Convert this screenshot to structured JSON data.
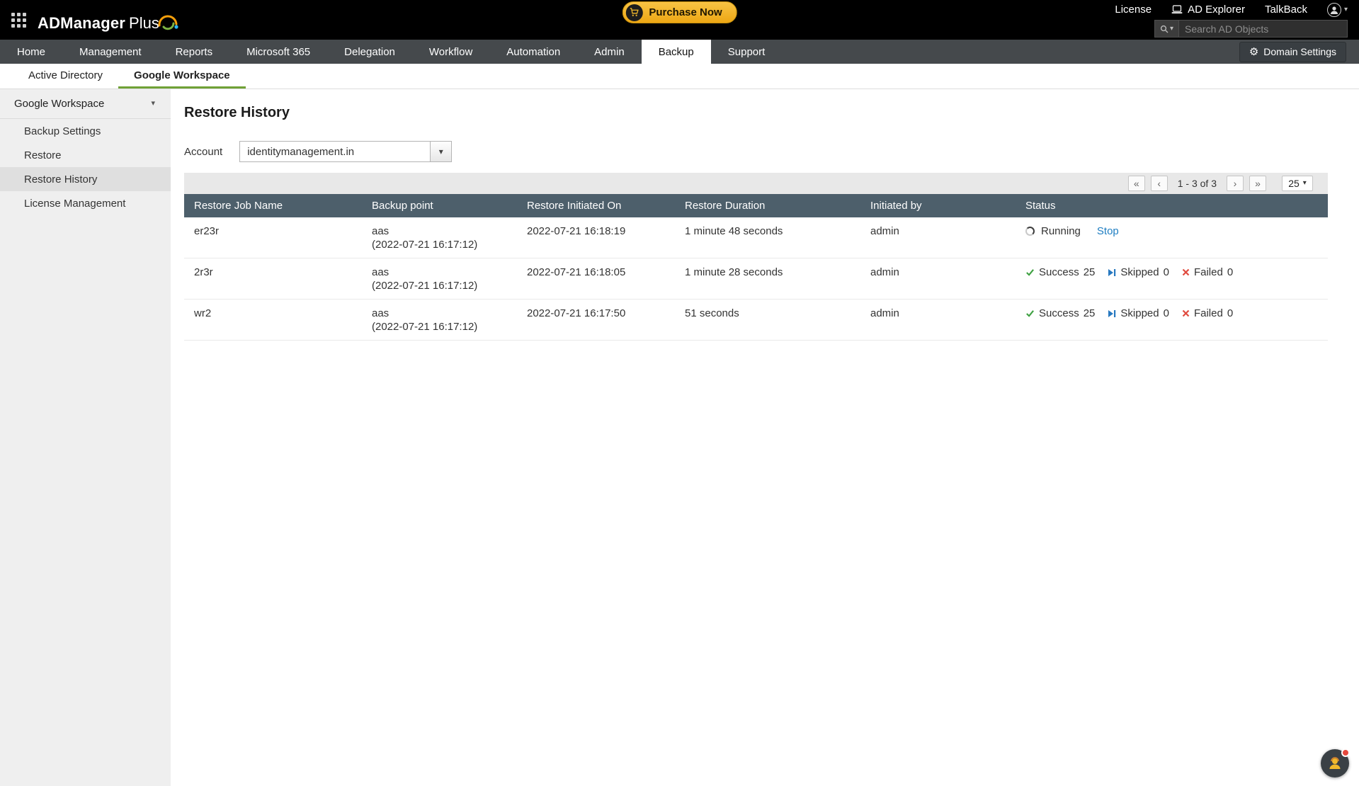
{
  "topbar": {
    "logo": {
      "part1": "ADManager",
      "part2": "Plus"
    },
    "purchase_button": "Purchase Now",
    "license": "License",
    "ad_explorer": "AD Explorer",
    "talkback": "TalkBack",
    "search_placeholder": "Search AD Objects"
  },
  "nav": {
    "tabs": [
      {
        "label": "Home"
      },
      {
        "label": "Management"
      },
      {
        "label": "Reports"
      },
      {
        "label": "Microsoft 365"
      },
      {
        "label": "Delegation"
      },
      {
        "label": "Workflow"
      },
      {
        "label": "Automation"
      },
      {
        "label": "Admin"
      },
      {
        "label": "Backup",
        "active": true
      },
      {
        "label": "Support"
      }
    ],
    "domain_settings": "Domain Settings"
  },
  "subtabs": [
    {
      "label": "Active Directory"
    },
    {
      "label": "Google Workspace",
      "active": true
    }
  ],
  "sidebar": {
    "header": "Google Workspace",
    "items": [
      {
        "label": "Backup Settings"
      },
      {
        "label": "Restore"
      },
      {
        "label": "Restore History",
        "active": true
      },
      {
        "label": "License Management"
      }
    ]
  },
  "main": {
    "title": "Restore History",
    "account_label": "Account",
    "account_value": "identitymanagement.in",
    "pagination": {
      "range": "1 - 3 of 3",
      "page_size": "25"
    },
    "table": {
      "columns": [
        "Restore Job Name",
        "Backup point",
        "Restore Initiated On",
        "Restore Duration",
        "Initiated by",
        "Status"
      ],
      "status_labels": {
        "running": "Running",
        "stop": "Stop",
        "success": "Success",
        "skipped": "Skipped",
        "failed": "Failed"
      },
      "rows": [
        {
          "job": "er23r",
          "backup_point": "aas",
          "backup_point_time": "(2022-07-21 16:17:12)",
          "initiated_on": "2022-07-21 16:18:19",
          "duration": "1 minute 48 seconds",
          "initiated_by": "admin"
        },
        {
          "job": "2r3r",
          "backup_point": "aas",
          "backup_point_time": "(2022-07-21 16:17:12)",
          "initiated_on": "2022-07-21 16:18:05",
          "duration": "1 minute 28 seconds",
          "initiated_by": "admin",
          "success": "25",
          "skipped": "0",
          "failed": "0"
        },
        {
          "job": "wr2",
          "backup_point": "aas",
          "backup_point_time": "(2022-07-21 16:17:12)",
          "initiated_on": "2022-07-21 16:17:50",
          "duration": "51 seconds",
          "initiated_by": "admin",
          "success": "25",
          "skipped": "0",
          "failed": "0"
        }
      ]
    }
  },
  "icons": {
    "gear": "⚙",
    "first_page": "«",
    "prev_page": "‹",
    "next_page": "›",
    "last_page": "»",
    "caret_down": "▾"
  },
  "colors": {
    "accent_green": "#6fa136",
    "purchase_gold": "#f0b41c",
    "table_header": "#4d5f6b",
    "success": "#3fa142",
    "skipped": "#2879c0",
    "failed": "#e04b3f",
    "link": "#1f7ec2"
  }
}
